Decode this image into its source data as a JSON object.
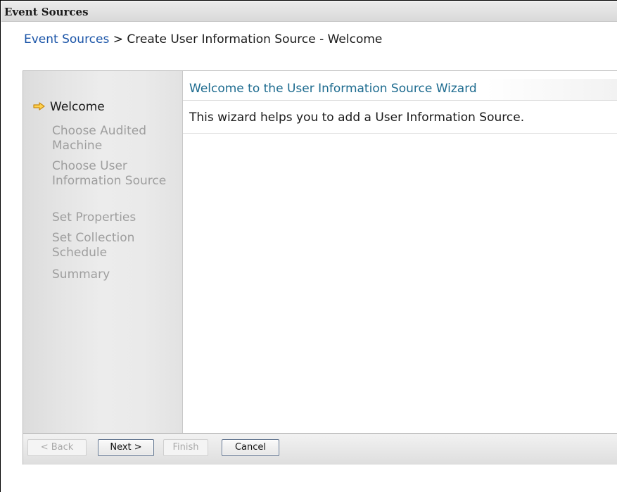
{
  "window": {
    "title": "Event Sources"
  },
  "breadcrumb": {
    "link": "Event Sources",
    "separator": " > ",
    "current": "Create User Information Source - Welcome"
  },
  "steps": [
    {
      "label": "Welcome",
      "state": "current"
    },
    {
      "label": "Choose Audited Machine",
      "state": "pending"
    },
    {
      "label": "Choose User Information Source",
      "state": "pending"
    },
    {
      "label": "Set Properties",
      "state": "pending"
    },
    {
      "label": "Set Collection Schedule",
      "state": "pending"
    },
    {
      "label": "Summary",
      "state": "pending"
    }
  ],
  "content": {
    "title": "Welcome to the User Information Source Wizard",
    "description": "This wizard helps you to add a User Information Source."
  },
  "buttons": {
    "back": "< Back",
    "next": "Next >",
    "finish": "Finish",
    "cancel": "Cancel"
  },
  "icons": {
    "current_step": "arrow-right-icon"
  },
  "colors": {
    "link": "#1b55a8",
    "content_title": "#1d6b8f",
    "step_arrow": "#f0b030"
  }
}
